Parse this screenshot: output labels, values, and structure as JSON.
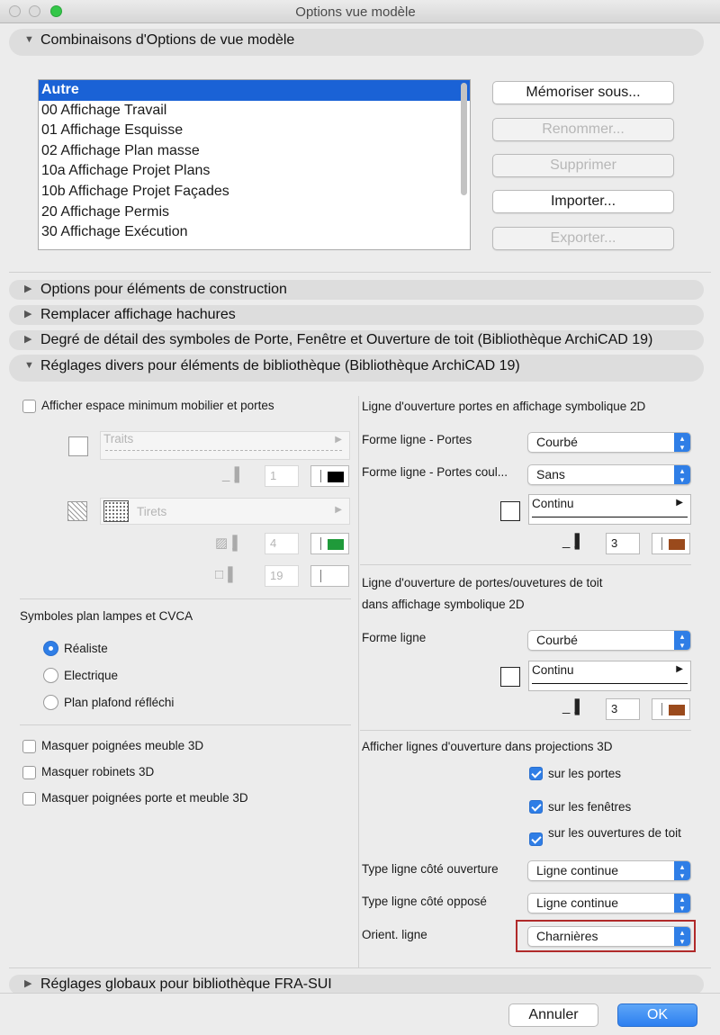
{
  "window": {
    "title": "Options vue modèle"
  },
  "sections": {
    "combinations": "Combinaisons d'Options de vue modèle",
    "construction": "Options pour éléments de construction",
    "hatching": "Remplacer affichage hachures",
    "detail": "Degré de détail des symboles de Porte, Fenêtre et Ouverture de toit (Bibliothèque ArchiCAD 19)",
    "misc": "Réglages divers pour éléments de bibliothèque (Bibliothèque ArchiCAD 19)",
    "global": "Réglages globaux pour bibliothèque FRA-SUI"
  },
  "combo_list": {
    "items": [
      "Autre",
      "00 Affichage Travail",
      "01 Affichage Esquisse",
      "02 Affichage Plan masse",
      "10a Affichage Projet Plans",
      "10b Affichage Projet Façades",
      "20 Affichage Permis",
      "30 Affichage Exécution"
    ],
    "selected_index": 0
  },
  "combo_buttons": {
    "memorize": "Mémoriser sous...",
    "rename": "Renommer...",
    "delete": "Supprimer",
    "import": "Importer...",
    "export": "Exporter..."
  },
  "left": {
    "min_space_label": "Afficher espace minimum mobilier et portes",
    "line_type_1": "Traits",
    "pen_1": "1",
    "fill_type": "Tirets",
    "pen_2": "4",
    "pen_3": "19",
    "lamps_title": "Symboles plan lampes et CVCA",
    "radios": [
      "Réaliste",
      "Electrique",
      "Plan plafond réfléchi"
    ],
    "radio_selected": 0,
    "hide_handles": "Masquer poignées meuble 3D",
    "hide_taps": "Masquer robinets 3D",
    "hide_door_handles": "Masquer poignées porte et meuble 3D"
  },
  "right": {
    "door_line_title": "Ligne d'ouverture portes en affichage symbolique 2D",
    "shape_doors_label": "Forme ligne - Portes",
    "shape_doors_value": "Courbé",
    "shape_sliding_label": "Forme ligne - Portes coul...",
    "shape_sliding_value": "Sans",
    "line_type_a": "Continu",
    "pen_a": "3",
    "roof_title_1": "Ligne d'ouverture de portes/ouvetures de toit",
    "roof_title_2": "dans affichage symbolique 2D",
    "shape_label": "Forme ligne",
    "shape_value": "Courbé",
    "line_type_b": "Continu",
    "pen_b": "3",
    "proj_title": "Afficher lignes d'ouverture dans projections 3D",
    "cb_doors": "sur les portes",
    "cb_windows": "sur les fenêtres",
    "cb_roof": "sur les ouvertures de toit",
    "opening_side_label": "Type ligne côté ouverture",
    "opening_side_value": "Ligne continue",
    "opposite_side_label": "Type ligne côté opposé",
    "opposite_side_value": "Ligne continue",
    "orient_label": "Orient. ligne",
    "orient_value": "Charnières"
  },
  "colors": {
    "pen_black": "#000000",
    "pen_green": "#1f9a3a",
    "pen_brown": "#9a4a1c",
    "highlight": "#1a62d6",
    "accent": "#2f7ee6",
    "orient_border": "#b02a2a"
  },
  "footer": {
    "cancel": "Annuler",
    "ok": "OK"
  }
}
